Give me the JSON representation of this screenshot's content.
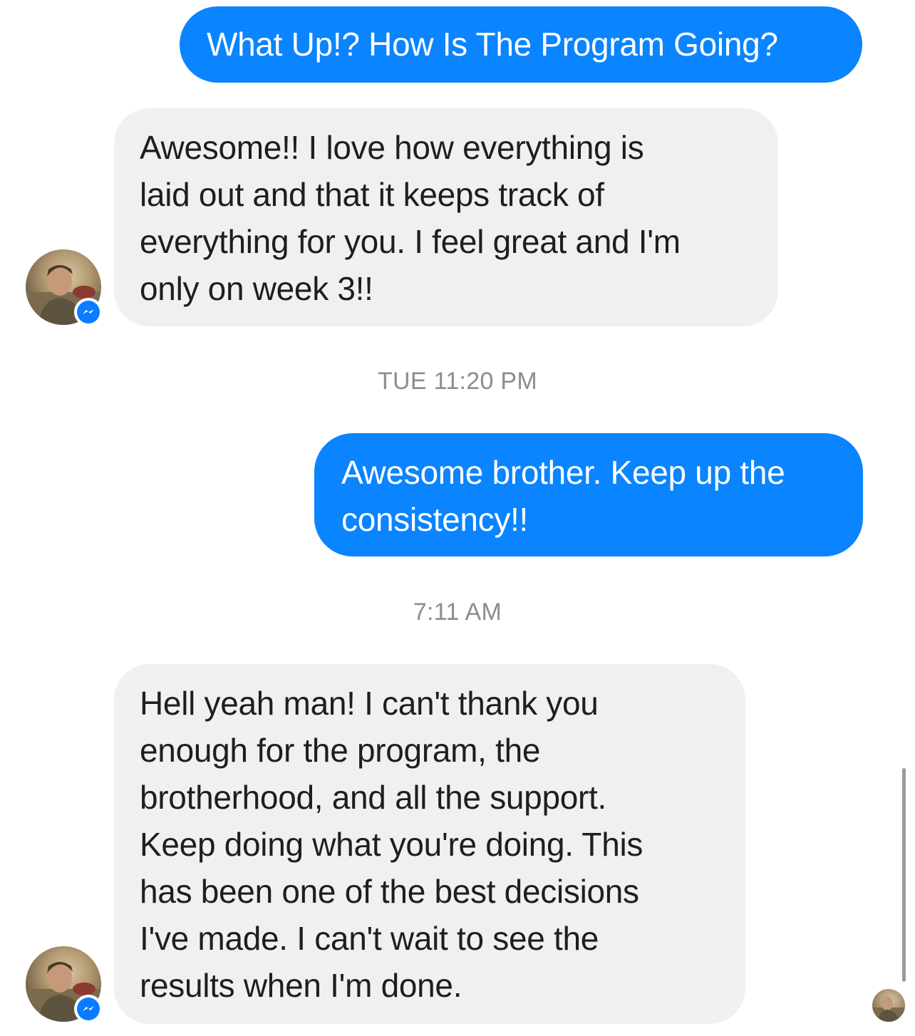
{
  "conversation": {
    "messages": [
      {
        "direction": "outgoing",
        "text": "What Up!? How Is The Program Going?"
      },
      {
        "direction": "incoming",
        "text": "Awesome!! I love how everything is\nlaid out and that it keeps track of\neverything for you. I feel great and I'm\nonly on week 3!!"
      },
      {
        "direction": "outgoing",
        "text": "Awesome brother. Keep up the\nconsistency!!"
      },
      {
        "direction": "incoming",
        "text": "Hell yeah man! I can't thank you\nenough for the program,  the\nbrotherhood, and all the support.\nKeep doing what you're doing.  This\nhas been one of the best decisions\nI've made.   I can't wait to see the\nresults when I'm done."
      }
    ],
    "timestamps": [
      "TUE 11:20 PM",
      "7:11 AM"
    ]
  },
  "icons": {
    "avatar": "contact-avatar",
    "badge": "messenger-icon",
    "read_receipt": "seen-avatar-icon"
  },
  "colors": {
    "outgoing_bubble": "#0a84ff",
    "incoming_bubble": "#f0f0f0",
    "timestamp_text": "#8a8d91"
  }
}
